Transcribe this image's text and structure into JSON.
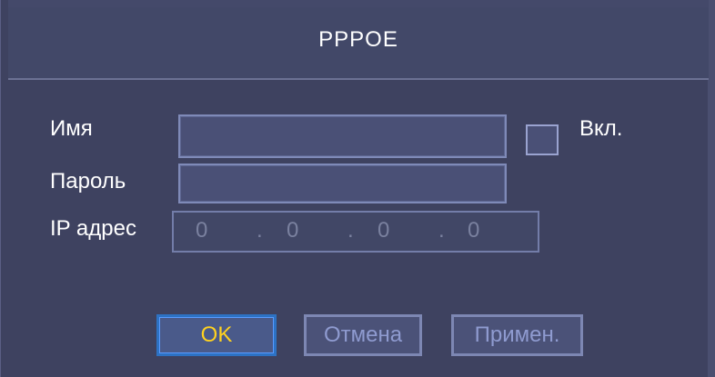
{
  "dialog": {
    "title": "PPPOE"
  },
  "form": {
    "name_label": "Имя",
    "name_value": "",
    "enable_label": "Вкл.",
    "enable_checked": false,
    "password_label": "Пароль",
    "password_value": "",
    "ip_label": "IP адрес",
    "ip_octets": [
      "0",
      "0",
      "0",
      "0"
    ],
    "ip_separator": "."
  },
  "buttons": {
    "ok": "OK",
    "cancel": "Отмена",
    "apply": "Примен."
  },
  "colors": {
    "background": "#3e4260",
    "field_border": "#7f8ab8",
    "ok_text": "#ffd21f",
    "ok_border": "#2d72c4",
    "button_text": "#8f9bd0",
    "disabled_text": "#7a819f"
  }
}
